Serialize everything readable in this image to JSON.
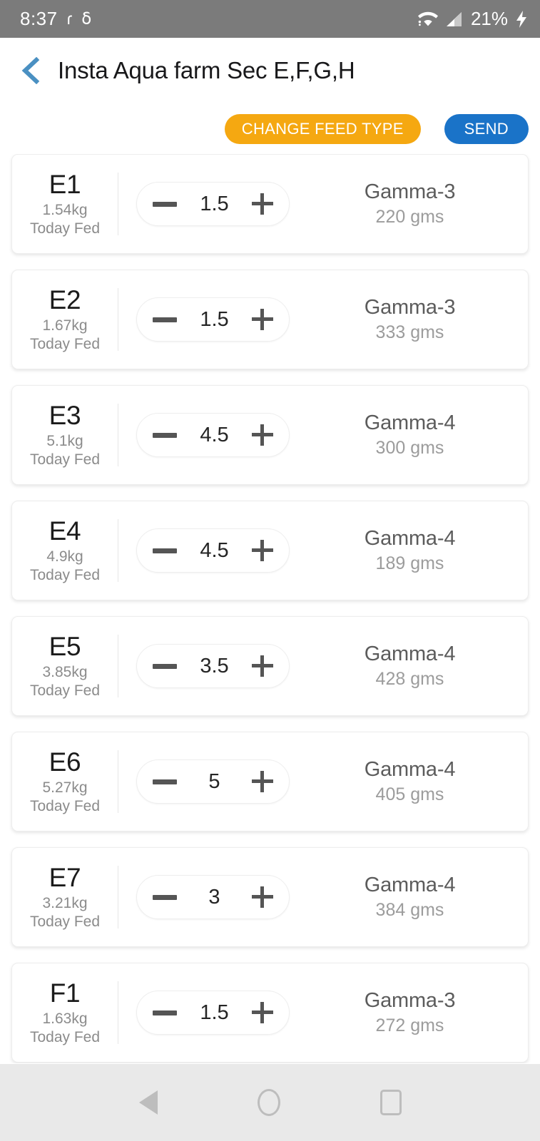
{
  "status_bar": {
    "time": "8:37",
    "notification_icons": [
      "app-notification-icon",
      "gmail-icon"
    ],
    "wifi_icon": "wifi-icon",
    "signal_icon": "cellular-signal-icon",
    "battery_percent": "21%",
    "charging_icon": "charging-bolt-icon",
    "background_color": "#7b7b7b"
  },
  "header": {
    "back_icon": "chevron-left-icon",
    "back_icon_color": "#4a90c2",
    "title": "Insta Aqua farm Sec  E,F,G,H"
  },
  "toolbar": {
    "change_feed_label": "CHANGE FEED TYPE",
    "change_feed_color": "#F5A811",
    "send_label": "SEND",
    "send_color": "#1A73C8"
  },
  "list": {
    "today_fed_label": "Today Fed",
    "minus_icon": "minus-icon",
    "plus_icon": "plus-icon",
    "rows": [
      {
        "pond": "E1",
        "weight": "1.54kg",
        "fed_label": "Today Fed",
        "value": "1.5",
        "feed_type": "Gamma-3",
        "feed_qty": "220 gms"
      },
      {
        "pond": "E2",
        "weight": "1.67kg",
        "fed_label": "Today Fed",
        "value": "1.5",
        "feed_type": "Gamma-3",
        "feed_qty": "333 gms"
      },
      {
        "pond": "E3",
        "weight": "5.1kg",
        "fed_label": "Today Fed",
        "value": "4.5",
        "feed_type": "Gamma-4",
        "feed_qty": "300 gms"
      },
      {
        "pond": "E4",
        "weight": "4.9kg",
        "fed_label": "Today Fed",
        "value": "4.5",
        "feed_type": "Gamma-4",
        "feed_qty": "189 gms"
      },
      {
        "pond": "E5",
        "weight": "3.85kg",
        "fed_label": "Today Fed",
        "value": "3.5",
        "feed_type": "Gamma-4",
        "feed_qty": "428 gms"
      },
      {
        "pond": "E6",
        "weight": "5.27kg",
        "fed_label": "Today Fed",
        "value": "5",
        "feed_type": "Gamma-4",
        "feed_qty": "405 gms"
      },
      {
        "pond": "E7",
        "weight": "3.21kg",
        "fed_label": "Today Fed",
        "value": "3",
        "feed_type": "Gamma-4",
        "feed_qty": "384 gms"
      },
      {
        "pond": "F1",
        "weight": "1.63kg",
        "fed_label": "Today Fed",
        "value": "1.5",
        "feed_type": "Gamma-3",
        "feed_qty": "272 gms"
      }
    ]
  },
  "nav_bar": {
    "back_icon": "nav-back-icon",
    "home_icon": "nav-home-icon",
    "recents_icon": "nav-recents-icon",
    "background_color": "#e9e9e9"
  }
}
